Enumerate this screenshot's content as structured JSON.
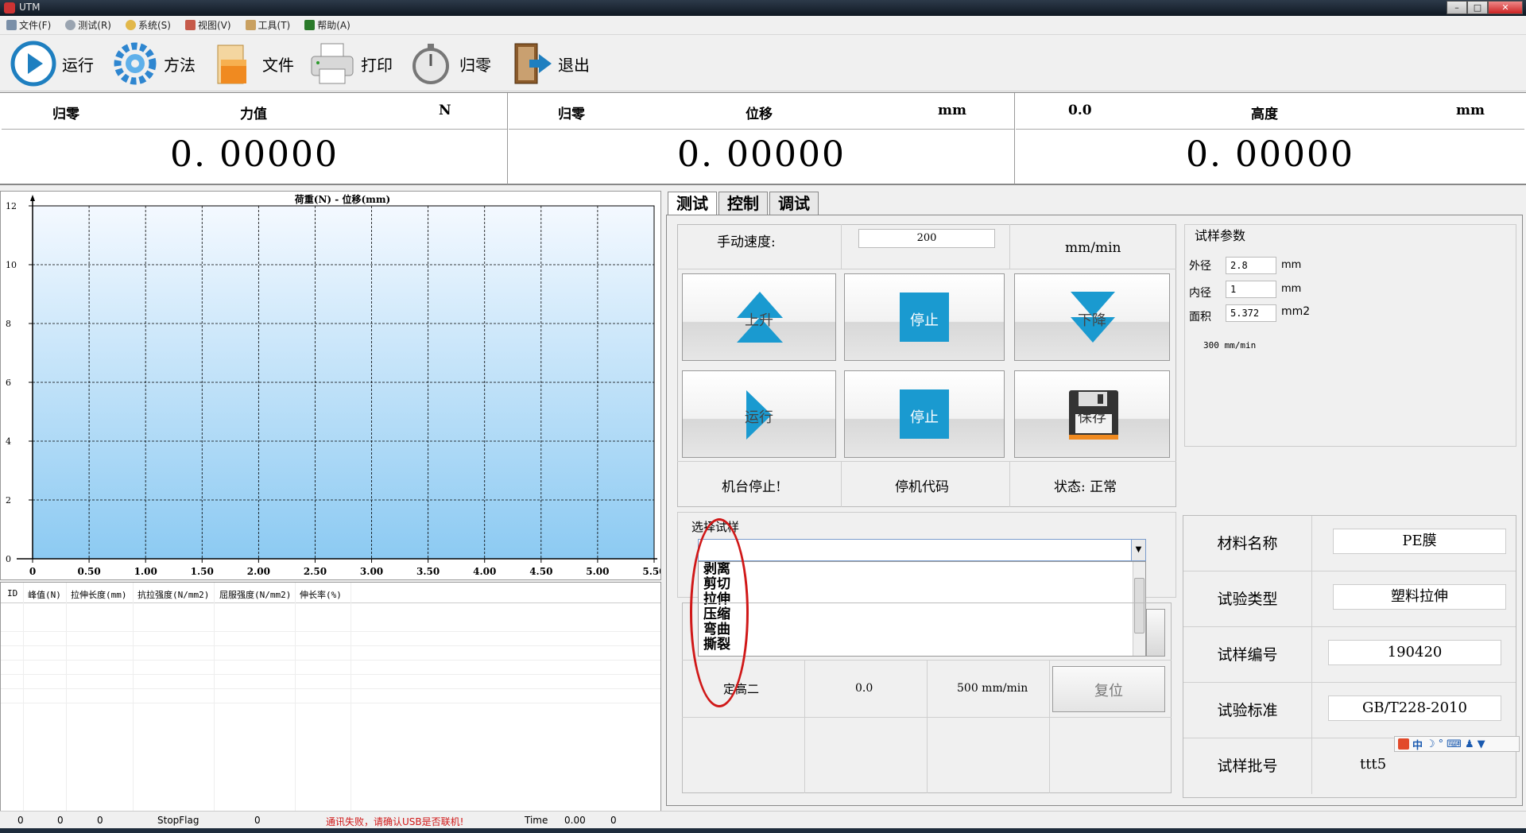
{
  "window": {
    "title": "UTM",
    "min": "–",
    "max": "□",
    "close": "✕"
  },
  "menu": [
    {
      "label": "文件(F)",
      "icon": "file-menu-icon",
      "color": "#7a8fa8"
    },
    {
      "label": "测试(R)",
      "icon": "test-menu-icon",
      "color": "#9aa4b0"
    },
    {
      "label": "系统(S)",
      "icon": "system-menu-icon",
      "color": "#e2b84a"
    },
    {
      "label": "视图(V)",
      "icon": "view-menu-icon",
      "color": "#c65a4a"
    },
    {
      "label": "工具(T)",
      "icon": "tools-menu-icon",
      "color": "#c9a060"
    },
    {
      "label": "帮助(A)",
      "icon": "help-menu-icon",
      "color": "#2a7a2a"
    }
  ],
  "toolbar": {
    "run": "运行",
    "method": "方法",
    "file": "文件",
    "print": "打印",
    "zero": "归零",
    "exit": "退出"
  },
  "readouts": [
    {
      "zero": "归零",
      "name": "力值",
      "unit": "N",
      "value": "0. 00000"
    },
    {
      "zero": "归零",
      "name": "位移",
      "unit": "mm",
      "value": "0. 00000"
    },
    {
      "zero": "0.0",
      "name": "高度",
      "unit": "mm",
      "value": "0. 00000"
    }
  ],
  "chart_data": {
    "type": "line",
    "title": "荷重(N) - 位移(mm)",
    "xlabel": "",
    "ylabel": "",
    "xlim": [
      0,
      5.5
    ],
    "ylim": [
      0,
      12
    ],
    "x_ticks": [
      "0",
      "0.50",
      "1.00",
      "1.50",
      "2.00",
      "2.50",
      "3.00",
      "3.50",
      "4.00",
      "4.50",
      "5.00",
      "5.50"
    ],
    "y_ticks": [
      "0",
      "2",
      "4",
      "6",
      "8",
      "10",
      "12"
    ],
    "grid": true,
    "series": []
  },
  "table": {
    "headers": [
      "ID",
      "峰值(N)",
      "拉伸长度(mm)",
      "抗拉强度(N/mm2)",
      "屈服强度(N/mm2)",
      "伸长率(%)"
    ]
  },
  "tabs": [
    "测试",
    "控制",
    "调试"
  ],
  "control": {
    "speed_label": "手动速度:",
    "speed_value": "200",
    "speed_unit": "mm/min",
    "up": "上升",
    "stop1": "停止",
    "down": "下降",
    "run": "运行",
    "stop2": "停止",
    "save": "保存",
    "machine_status": "机台停止!",
    "stop_code": "停机代码",
    "state": "状态: 正常"
  },
  "params": {
    "title": "试样参数",
    "outer_label": "外径",
    "outer_value": "2.8",
    "outer_unit": "mm",
    "inner_label": "内径",
    "inner_value": "1",
    "inner_unit": "mm",
    "area_label": "面积",
    "area_value": "5.372",
    "area_unit": "mm2",
    "speed": "300 mm/min"
  },
  "selector": {
    "caption": "选择试样",
    "value": "",
    "options": [
      "剥离",
      "剪切",
      "拉伸",
      "压缩",
      "弯曲",
      "撕裂"
    ]
  },
  "lower": {
    "fixed_height": "定高二",
    "value": "0.0",
    "speed": "500 mm/min",
    "reset": "复位"
  },
  "info": [
    {
      "label": "材料名称",
      "value": "PE膜"
    },
    {
      "label": "试验类型",
      "value": "塑料拉伸"
    },
    {
      "label": "试样编号",
      "value": "190420"
    },
    {
      "label": "试验标准",
      "value": "GB/T228-2010"
    },
    {
      "label": "试样批号",
      "value": "ttt5"
    }
  ],
  "status": {
    "s1": "0",
    "s2": "0",
    "s3": "0",
    "flag_label": "StopFlag",
    "flag_value": "0",
    "message": "通讯失败，请确认USB是否联机!",
    "time_label": "Time",
    "time_value": "0.00",
    "tail": "0"
  },
  "ime": {
    "label": "中"
  },
  "colors": {
    "accent": "#1a9ad0",
    "error": "#d01818"
  }
}
